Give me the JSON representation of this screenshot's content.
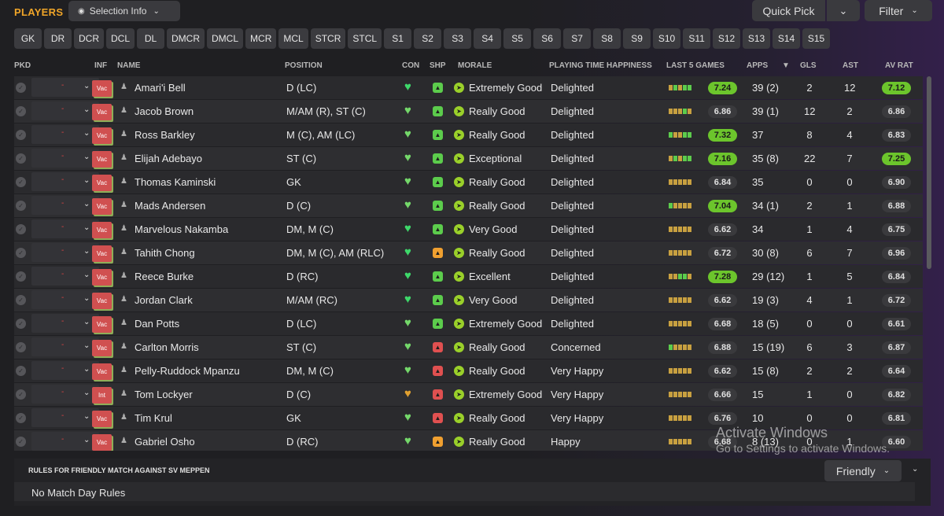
{
  "header": {
    "title": "PLAYERS",
    "selection_info": "Selection Info",
    "quick_pick": "Quick Pick",
    "filter": "Filter"
  },
  "positions": [
    "GK",
    "DR",
    "DCR",
    "DCL",
    "DL",
    "DMCR",
    "DMCL",
    "MCR",
    "MCL",
    "STCR",
    "STCL",
    "S1",
    "S2",
    "S3",
    "S4",
    "S5",
    "S6",
    "S7",
    "S8",
    "S9",
    "S10",
    "S11",
    "S12",
    "S13",
    "S14",
    "S15"
  ],
  "columns": {
    "pkd": "PKD",
    "inf": "INF",
    "name": "NAME",
    "position": "POSITION",
    "con": "CON",
    "shp": "SHP",
    "morale": "MORALE",
    "happiness": "PLAYING TIME HAPPINESS",
    "last5": "LAST 5 GAMES",
    "apps": "APPS",
    "gls": "GLS",
    "ast": "AST",
    "avrat": "AV RAT"
  },
  "colors": {
    "accent": "#f0a528",
    "good": "#6cc52c",
    "neutral": "#3a3a3d",
    "inf_badge": "#d05050"
  },
  "players": [
    {
      "inf": "Vac",
      "name": "Amari'i Bell",
      "position": "D (LC)",
      "con": "full",
      "shp": "green",
      "morale": "Extremely Good",
      "happiness": "Delighted",
      "form": [
        "o",
        "g",
        "o",
        "g",
        "g"
      ],
      "form_rating": "7.24",
      "form_high": true,
      "apps": "39 (2)",
      "gls": "2",
      "ast": "12",
      "av_rat": "7.12",
      "av_high": true
    },
    {
      "inf": "Vac",
      "name": "Jacob Brown",
      "position": "M/AM (R), ST (C)",
      "con": "good",
      "shp": "green",
      "morale": "Really Good",
      "happiness": "Delighted",
      "form": [
        "o",
        "o",
        "o",
        "g",
        "o"
      ],
      "form_rating": "6.86",
      "form_high": false,
      "apps": "39 (1)",
      "gls": "12",
      "ast": "2",
      "av_rat": "6.86",
      "av_high": false
    },
    {
      "inf": "Vac",
      "name": "Ross Barkley",
      "position": "M (C), AM (LC)",
      "con": "good",
      "shp": "green",
      "morale": "Really Good",
      "happiness": "Delighted",
      "form": [
        "g",
        "o",
        "o",
        "g",
        "g"
      ],
      "form_rating": "7.32",
      "form_high": true,
      "apps": "37",
      "gls": "8",
      "ast": "4",
      "av_rat": "6.83",
      "av_high": false
    },
    {
      "inf": "Vac",
      "name": "Elijah Adebayo",
      "position": "ST (C)",
      "con": "good",
      "shp": "green",
      "morale": "Exceptional",
      "happiness": "Delighted",
      "form": [
        "o",
        "g",
        "o",
        "g",
        "g"
      ],
      "form_rating": "7.16",
      "form_high": true,
      "apps": "35 (8)",
      "gls": "22",
      "ast": "7",
      "av_rat": "7.25",
      "av_high": true
    },
    {
      "inf": "Vac",
      "name": "Thomas Kaminski",
      "position": "GK",
      "con": "good",
      "shp": "green",
      "morale": "Really Good",
      "happiness": "Delighted",
      "form": [
        "o",
        "o",
        "o",
        "o",
        "o"
      ],
      "form_rating": "6.84",
      "form_high": false,
      "apps": "35",
      "gls": "0",
      "ast": "0",
      "av_rat": "6.90",
      "av_high": false
    },
    {
      "inf": "Vac",
      "name": "Mads Andersen",
      "position": "D (C)",
      "con": "good",
      "shp": "green",
      "morale": "Really Good",
      "happiness": "Delighted",
      "form": [
        "g",
        "o",
        "o",
        "o",
        "o"
      ],
      "form_rating": "7.04",
      "form_high": true,
      "apps": "34 (1)",
      "gls": "2",
      "ast": "1",
      "av_rat": "6.88",
      "av_high": false
    },
    {
      "inf": "Vac",
      "name": "Marvelous Nakamba",
      "position": "DM, M (C)",
      "con": "full",
      "shp": "green",
      "morale": "Very Good",
      "happiness": "Delighted",
      "form": [
        "o",
        "o",
        "o",
        "o",
        "o"
      ],
      "form_rating": "6.62",
      "form_high": false,
      "apps": "34",
      "gls": "1",
      "ast": "4",
      "av_rat": "6.75",
      "av_high": false
    },
    {
      "inf": "Vac",
      "name": "Tahith Chong",
      "position": "DM, M (C), AM (RLC)",
      "con": "full",
      "shp": "orange",
      "morale": "Really Good",
      "happiness": "Delighted",
      "form": [
        "o",
        "o",
        "o",
        "o",
        "o"
      ],
      "form_rating": "6.72",
      "form_high": false,
      "apps": "30 (8)",
      "gls": "6",
      "ast": "7",
      "av_rat": "6.96",
      "av_high": false
    },
    {
      "inf": "Vac",
      "name": "Reece Burke",
      "position": "D (RC)",
      "con": "full",
      "shp": "green",
      "morale": "Excellent",
      "happiness": "Delighted",
      "form": [
        "o",
        "o",
        "g",
        "g",
        "o"
      ],
      "form_rating": "7.28",
      "form_high": true,
      "apps": "29 (12)",
      "gls": "1",
      "ast": "5",
      "av_rat": "6.84",
      "av_high": false
    },
    {
      "inf": "Vac",
      "name": "Jordan Clark",
      "position": "M/AM (RC)",
      "con": "full",
      "shp": "green",
      "morale": "Very Good",
      "happiness": "Delighted",
      "form": [
        "o",
        "o",
        "o",
        "o",
        "o"
      ],
      "form_rating": "6.62",
      "form_high": false,
      "apps": "19 (3)",
      "gls": "4",
      "ast": "1",
      "av_rat": "6.72",
      "av_high": false
    },
    {
      "inf": "Vac",
      "name": "Dan Potts",
      "position": "D (LC)",
      "con": "good",
      "shp": "green",
      "morale": "Extremely Good",
      "happiness": "Delighted",
      "form": [
        "o",
        "o",
        "o",
        "o",
        "o"
      ],
      "form_rating": "6.68",
      "form_high": false,
      "apps": "18 (5)",
      "gls": "0",
      "ast": "0",
      "av_rat": "6.61",
      "av_high": false
    },
    {
      "inf": "Vac",
      "name": "Carlton Morris",
      "position": "ST (C)",
      "con": "good",
      "shp": "red",
      "morale": "Really Good",
      "happiness": "Concerned",
      "form": [
        "g",
        "o",
        "o",
        "o",
        "o"
      ],
      "form_rating": "6.88",
      "form_high": false,
      "apps": "15 (19)",
      "gls": "6",
      "ast": "3",
      "av_rat": "6.87",
      "av_high": false
    },
    {
      "inf": "Vac",
      "name": "Pelly-Ruddock Mpanzu",
      "position": "DM, M (C)",
      "con": "good",
      "shp": "red",
      "morale": "Really Good",
      "happiness": "Very Happy",
      "form": [
        "o",
        "o",
        "o",
        "o",
        "o"
      ],
      "form_rating": "6.62",
      "form_high": false,
      "apps": "15 (8)",
      "gls": "2",
      "ast": "2",
      "av_rat": "6.64",
      "av_high": false
    },
    {
      "inf": "Int",
      "name": "Tom Lockyer",
      "position": "D (C)",
      "con": "warn",
      "shp": "red",
      "morale": "Extremely Good",
      "happiness": "Very Happy",
      "form": [
        "o",
        "o",
        "o",
        "o",
        "o"
      ],
      "form_rating": "6.66",
      "form_high": false,
      "apps": "15",
      "gls": "1",
      "ast": "0",
      "av_rat": "6.82",
      "av_high": false
    },
    {
      "inf": "Vac",
      "name": "Tim Krul",
      "position": "GK",
      "con": "good",
      "shp": "red",
      "morale": "Really Good",
      "happiness": "Very Happy",
      "form": [
        "o",
        "o",
        "o",
        "o",
        "o"
      ],
      "form_rating": "6.76",
      "form_high": false,
      "apps": "10",
      "gls": "0",
      "ast": "0",
      "av_rat": "6.81",
      "av_high": false
    },
    {
      "inf": "Vac",
      "name": "Gabriel Osho",
      "position": "D (RC)",
      "con": "good",
      "shp": "orange",
      "morale": "Really Good",
      "happiness": "Happy",
      "form": [
        "o",
        "o",
        "o",
        "o",
        "o"
      ],
      "form_rating": "6.68",
      "form_high": false,
      "apps": "8 (13)",
      "gls": "0",
      "ast": "1",
      "av_rat": "6.60",
      "av_high": false
    }
  ],
  "rules": {
    "title": "RULES FOR FRIENDLY MATCH AGAINST SV MEPPEN",
    "text": "No Match Day Rules",
    "type": "Friendly"
  },
  "watermark": {
    "line1": "Activate Windows",
    "line2": "Go to Settings to activate Windows."
  }
}
